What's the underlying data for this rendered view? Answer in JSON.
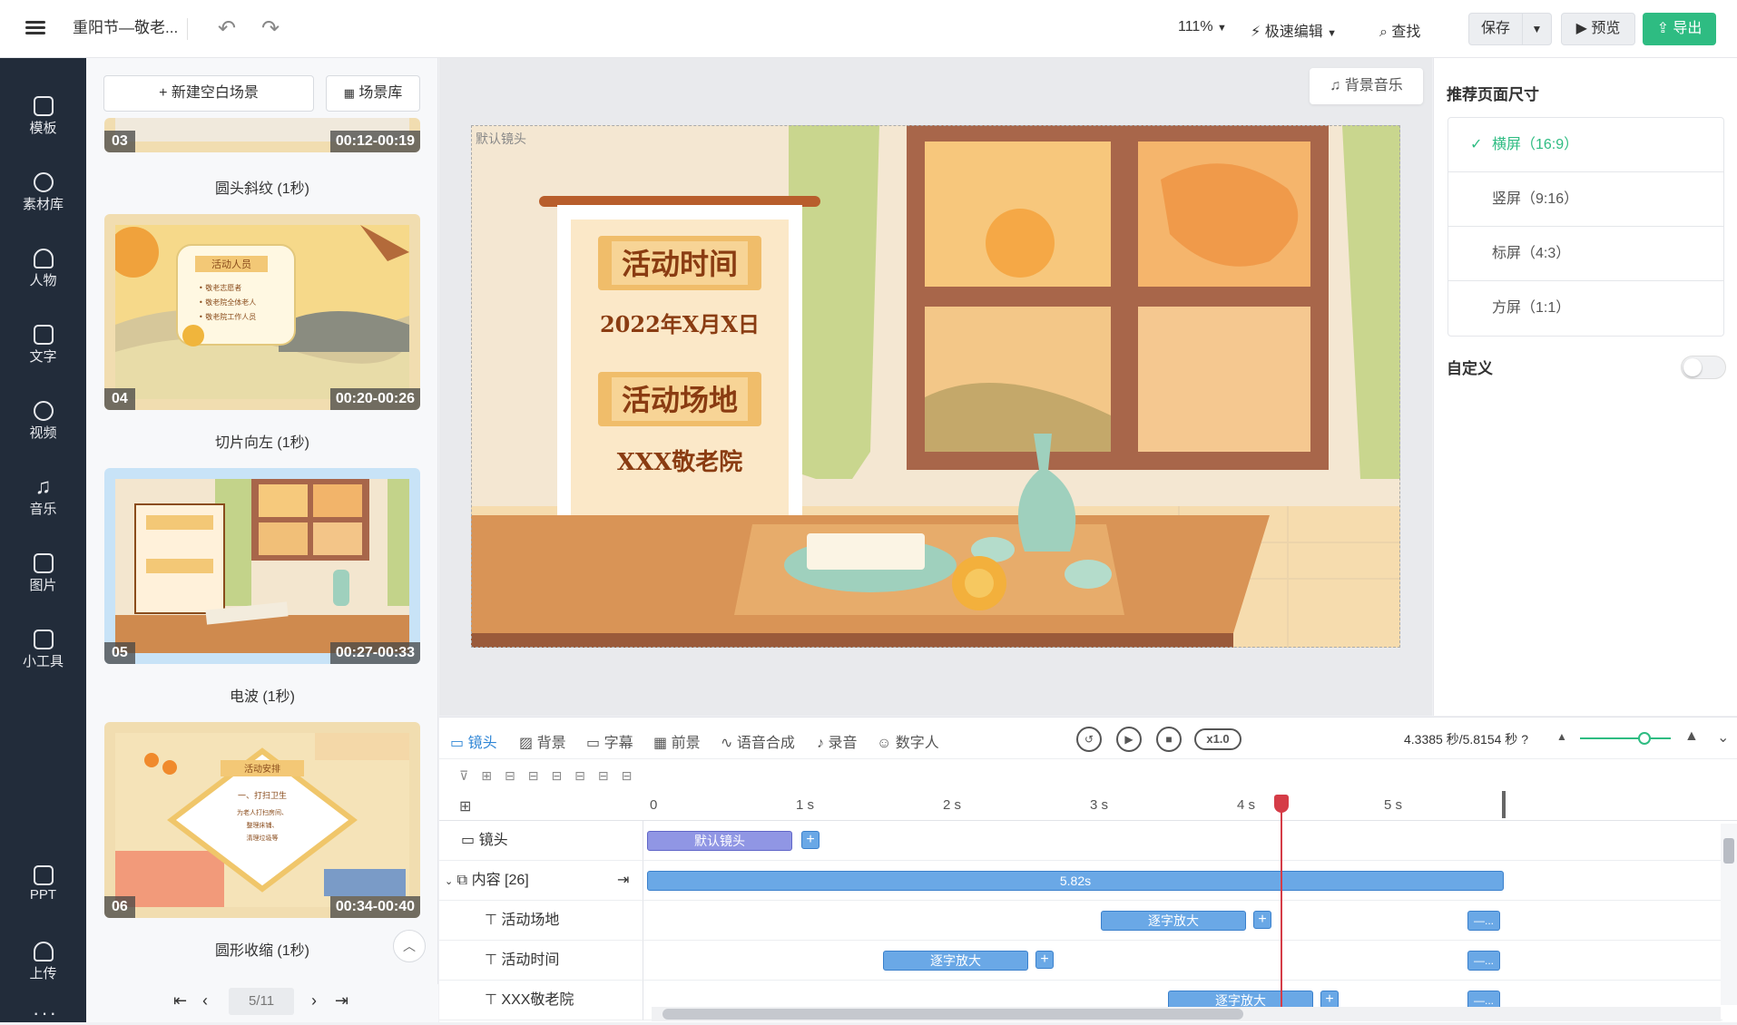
{
  "header": {
    "doc_title": "重阳节—敬老...",
    "zoom": "111%",
    "speed_edit": "极速编辑",
    "find": "查找",
    "save": "保存",
    "preview": "预览",
    "export": "导出"
  },
  "sidebar": {
    "items": [
      {
        "label": "模板",
        "icon": "template-icon"
      },
      {
        "label": "素材库",
        "icon": "materials-icon"
      },
      {
        "label": "人物",
        "icon": "person-icon"
      },
      {
        "label": "文字",
        "icon": "text-icon"
      },
      {
        "label": "视频",
        "icon": "video-icon"
      },
      {
        "label": "音乐",
        "icon": "music-icon"
      },
      {
        "label": "图片",
        "icon": "image-icon"
      },
      {
        "label": "小工具",
        "icon": "tools-icon"
      },
      {
        "label": "PPT",
        "icon": "ppt-icon"
      },
      {
        "label": "上传",
        "icon": "upload-icon"
      }
    ]
  },
  "scenes": {
    "new_blank": "新建空白场景",
    "library": "场景库",
    "items": [
      {
        "num": "03",
        "time": "00:12-00:19",
        "caption": "圆头斜纹 (1秒)"
      },
      {
        "num": "04",
        "time": "00:20-00:26",
        "caption": "切片向左 (1秒)"
      },
      {
        "num": "05",
        "time": "00:27-00:33",
        "caption": "电波 (1秒)"
      },
      {
        "num": "06",
        "time": "00:34-00:40",
        "caption": "圆形收缩 (1秒)"
      }
    ],
    "thumb_text": {
      "s04_title": "活动人员",
      "s04_lines": [
        "• 敬老志愿者",
        "• 敬老院全体老人",
        "• 敬老院工作人员"
      ],
      "s06_title": "活动安排",
      "s06_lines": [
        "一、打扫卫生",
        "为老人打扫房间、",
        "整理床铺、",
        "清理垃圾等"
      ]
    },
    "pager": "5/11"
  },
  "canvas": {
    "bg_music": "背景音乐",
    "default_camera": "默认镜头",
    "scroll": {
      "title1": "活动时间",
      "date": "2022年X月X日",
      "title2": "活动场地",
      "place": "XXX敬老院"
    }
  },
  "page_size": {
    "title": "推荐页面尺寸",
    "options": [
      {
        "label": "横屏（16:9）",
        "active": true
      },
      {
        "label": "竖屏（9:16）",
        "active": false
      },
      {
        "label": "标屏（4:3）",
        "active": false
      },
      {
        "label": "方屏（1:1）",
        "active": false
      }
    ],
    "custom": "自定义"
  },
  "timeline": {
    "tabs": [
      "镜头",
      "背景",
      "字幕",
      "前景",
      "语音合成",
      "录音",
      "数字人"
    ],
    "speed": "x1.0",
    "time_info": "4.3385 秒/5.8154 秒",
    "ruler_ticks": [
      "0",
      "1 s",
      "2 s",
      "3 s",
      "4 s",
      "5 s"
    ],
    "tracks": {
      "camera": {
        "label": "镜头",
        "clip": "默认镜头"
      },
      "content": {
        "label": "内容 [26]",
        "clip": "5.82s"
      },
      "venue": {
        "label": "活动场地",
        "clip": "逐字放大",
        "end": "—..."
      },
      "time": {
        "label": "活动时间",
        "clip": "逐字放大",
        "end": "—..."
      },
      "home": {
        "label": "XXX敬老院",
        "clip": "逐字放大",
        "end": "—..."
      }
    }
  }
}
